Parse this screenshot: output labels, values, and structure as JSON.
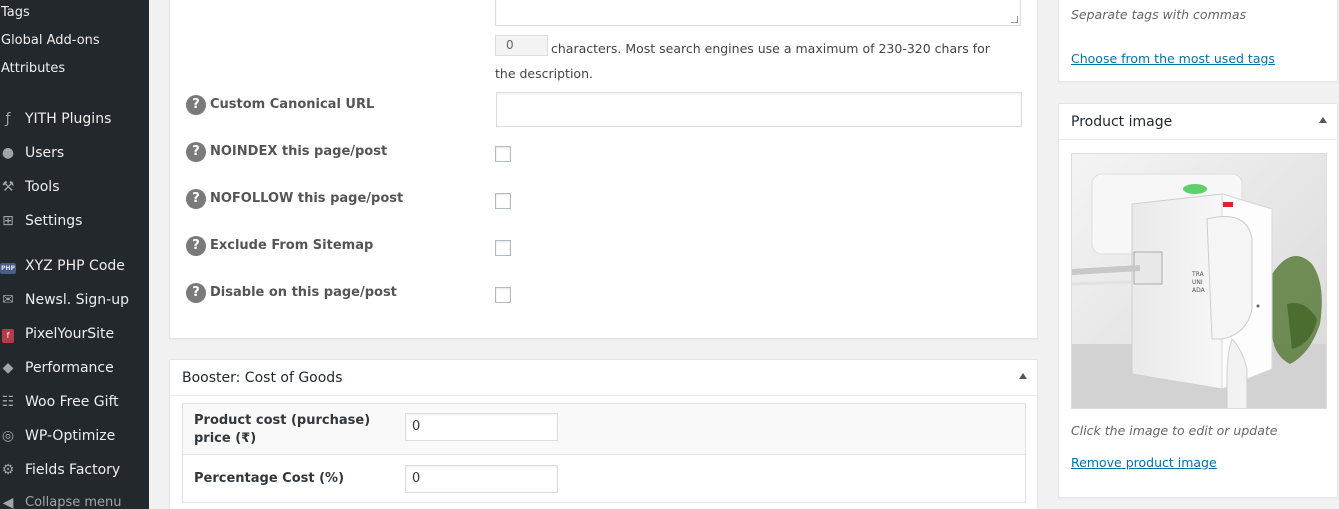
{
  "sidebar": {
    "submenu": [
      "Tags",
      "Global Add-ons",
      "Attributes"
    ],
    "items": [
      {
        "label": "YITH Plugins",
        "icon": "yith-icon",
        "glyph": "ƒ"
      },
      {
        "label": "Users",
        "icon": "users-icon",
        "glyph": "●"
      },
      {
        "label": "Tools",
        "icon": "wrench-icon",
        "glyph": "⚒"
      },
      {
        "label": "Settings",
        "icon": "settings-icon",
        "glyph": "⊞"
      },
      {
        "label": "XYZ PHP Code",
        "icon": "php-icon",
        "glyph": "PHP"
      },
      {
        "label": "Newsl. Sign-up",
        "icon": "envelope-icon",
        "glyph": "✉"
      },
      {
        "label": "PixelYourSite",
        "icon": "pixelyoursite-icon",
        "glyph": "f"
      },
      {
        "label": "Performance",
        "icon": "performance-icon",
        "glyph": "◆"
      },
      {
        "label": "Woo Free Gift",
        "icon": "cart-icon",
        "glyph": "☷"
      },
      {
        "label": "WP-Optimize",
        "icon": "wp-optimize-icon",
        "glyph": "◎"
      },
      {
        "label": "Fields Factory",
        "icon": "gear-icon",
        "glyph": "⚙"
      }
    ],
    "collapse": {
      "label": "Collapse menu",
      "icon": "collapse-icon",
      "glyph": "◀"
    }
  },
  "seo": {
    "char_count": "0",
    "char_description": "characters. Most search engines use a maximum of 230-320 chars for the description.",
    "rows": [
      {
        "label": "Custom Canonical URL",
        "type": "text"
      },
      {
        "label": "NOINDEX this page/post",
        "type": "checkbox",
        "checked": false
      },
      {
        "label": "NOFOLLOW this page/post",
        "type": "checkbox",
        "checked": false
      },
      {
        "label": "Exclude From Sitemap",
        "type": "checkbox",
        "checked": false
      },
      {
        "label": "Disable on this page/post",
        "type": "checkbox",
        "checked": false
      }
    ],
    "help_glyph": "?"
  },
  "booster": {
    "title": "Booster: Cost of Goods",
    "fields": [
      {
        "label": "Product cost (purchase) price (₹)",
        "value": "0"
      },
      {
        "label": "Percentage Cost (%)",
        "value": "0"
      }
    ]
  },
  "tags": {
    "hint": "Separate tags with commas",
    "most_used_link": "Choose from the most used tags"
  },
  "product_image": {
    "title": "Product image",
    "hint": "Click the image to edit or update",
    "remove_link": "Remove product image",
    "plug_text": "TRA\nUNI\nADA"
  },
  "colors": {
    "sidebar_bg": "#23282d",
    "link": "#0073aa"
  }
}
